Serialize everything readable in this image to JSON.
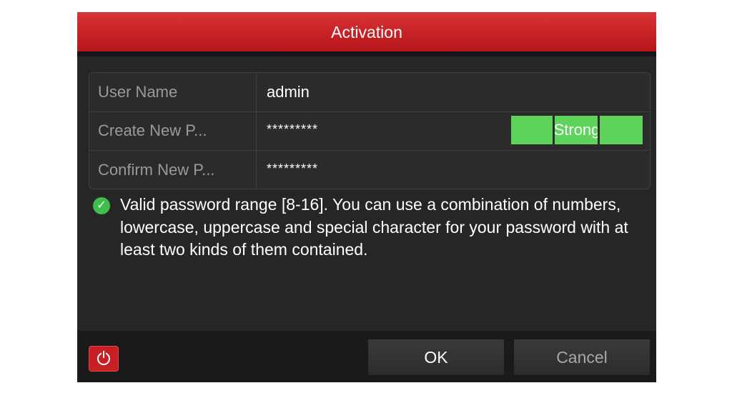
{
  "dialog": {
    "title": "Activation"
  },
  "form": {
    "user_name_label": "User Name",
    "user_name_value": "admin",
    "create_password_label": "Create New P...",
    "create_password_value": "*********",
    "password_strength": "Strong",
    "confirm_password_label": "Confirm New P...",
    "confirm_password_value": "*********"
  },
  "hint": {
    "icon": "check-circle-icon",
    "text": "Valid password range [8-16]. You can use a combination of numbers, lowercase, uppercase and special character for your password with at least two kinds of them contained."
  },
  "footer": {
    "power_icon": "power-icon",
    "ok_label": "OK",
    "cancel_label": "Cancel"
  },
  "colors": {
    "title_bar": "#c41f23",
    "strength_bar": "#5fd45a",
    "check_icon": "#3fbe4c",
    "background": "#262626"
  }
}
